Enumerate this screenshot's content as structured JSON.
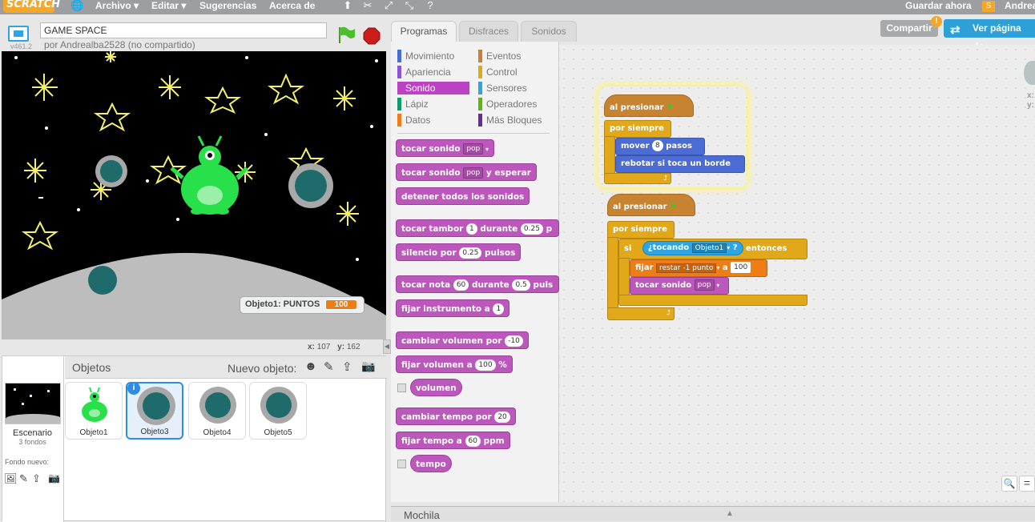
{
  "topbar": {
    "logo": "SCRATCH",
    "menu_file": "Archivo ▾",
    "menu_edit": "Editar ▾",
    "menu_tips": "Sugerencias",
    "menu_about": "Acerca de",
    "save_now": "Guardar ahora",
    "user": "Andrea"
  },
  "stage_header": {
    "version": "v461.2",
    "project_title": "GAME SPACE",
    "byline": "por Andrealba2528 (no compartido)"
  },
  "stage": {
    "variable_label": "Objeto1: PUNTOS",
    "variable_value": "100",
    "x_label": "x:",
    "x_value": "107",
    "y_label": "y:",
    "y_value": "162"
  },
  "sprites": {
    "header": "Objetos",
    "new_sprite": "Nuevo objeto:",
    "stage_label": "Escenario",
    "stage_backdrops": "3 fondos",
    "new_backdrop": "Fondo nuevo:",
    "items": [
      "Objeto1",
      "Objeto3",
      "Objeto4",
      "Objeto5"
    ],
    "selected": "Objeto3"
  },
  "tabs": {
    "scripts": "Programas",
    "costumes": "Disfraces",
    "sounds": "Sonidos"
  },
  "categories": {
    "left": [
      "Movimiento",
      "Apariencia",
      "Sonido",
      "Lápiz",
      "Datos"
    ],
    "right": [
      "Eventos",
      "Control",
      "Sensores",
      "Operadores",
      "Más Bloques"
    ],
    "selected": "Sonido",
    "colors": {
      "Movimiento": "#4a6cd4",
      "Apariencia": "#8a55d7",
      "Sonido": "#bb42c3",
      "Lápiz": "#0e9a6c",
      "Datos": "#ee7d16",
      "Eventos": "#c88330",
      "Control": "#e1a91a",
      "Sensores": "#2ca5e2",
      "Operadores": "#5cb712",
      "Más Bloques": "#632d99"
    }
  },
  "palette_blocks": {
    "play_sound": "tocar sonido",
    "play_sound_arg": "pop",
    "play_until": "tocar sonido",
    "play_until_arg": "pop",
    "play_until_tail": "y esperar",
    "stop_all": "detener todos los sonidos",
    "drum": "tocar tambor",
    "drum_arg": "1",
    "drum_mid": "durante",
    "drum_val": "0.25",
    "drum_tail": "p",
    "rest": "silencio por",
    "rest_val": "0.25",
    "rest_tail": "pulsos",
    "note": "tocar nota",
    "note_arg": "60",
    "note_mid": "durante",
    "note_val": "0.5",
    "note_tail": "puls",
    "instrument": "fijar instrumento a",
    "instrument_arg": "1",
    "change_vol": "cambiar volumen por",
    "change_vol_val": "-10",
    "set_vol": "fijar volumen a",
    "set_vol_val": "100",
    "set_vol_tail": "%",
    "volume": "volumen",
    "change_tempo": "cambiar tempo por",
    "change_tempo_val": "20",
    "set_tempo": "fijar tempo a",
    "set_tempo_val": "60",
    "set_tempo_tail": "ppm",
    "tempo": "tempo"
  },
  "scripts": {
    "s1_hat": "al presionar",
    "s1_forever": "por siempre",
    "s1_move": "mover",
    "s1_move_val": "8",
    "s1_move_tail": "pasos",
    "s1_bounce": "rebotar si toca un borde",
    "s2_hat": "al presionar",
    "s2_forever": "por siempre",
    "s2_if": "si",
    "s2_touching": "¿tocando",
    "s2_touching_arg": "Objeto1",
    "s2_q": "?",
    "s2_then": "entonces",
    "s2_set": "fijar",
    "s2_set_var": "restar -1 punto",
    "s2_set_to": "a",
    "s2_set_val": "100",
    "s2_play": "tocar sonido",
    "s2_play_arg": "pop"
  },
  "topright": {
    "share": "Compartir",
    "see_page": "Ver página de"
  },
  "script_area": {
    "x_label": "x:",
    "y_label": "y:"
  },
  "backpack": "Mochila"
}
